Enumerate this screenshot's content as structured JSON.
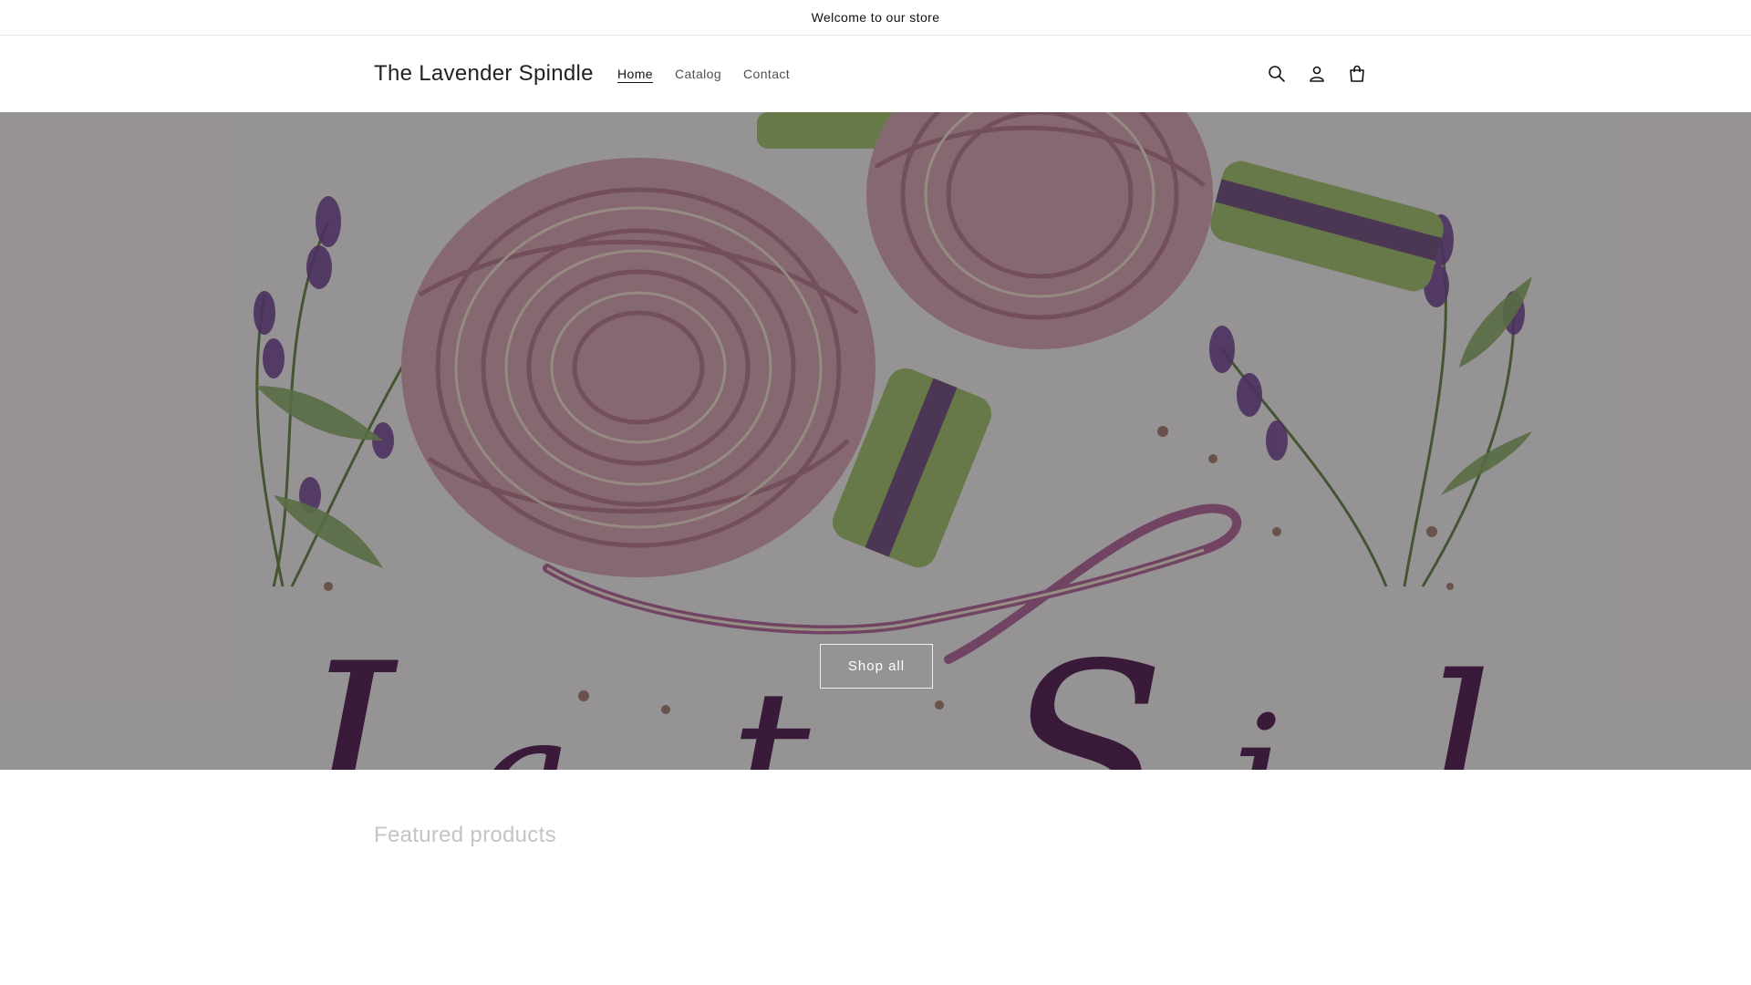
{
  "announcement": {
    "text": "Welcome to our store"
  },
  "header": {
    "logo": "The Lavender Spindle",
    "nav": [
      {
        "label": "Home",
        "active": true
      },
      {
        "label": "Catalog",
        "active": false
      },
      {
        "label": "Contact",
        "active": false
      }
    ],
    "icons": [
      "search-icon",
      "account-icon",
      "cart-icon"
    ]
  },
  "hero": {
    "button_label": "Shop all",
    "overlay_color": "#000000",
    "yarn_color": "#d9a9b6",
    "lavender_color": "#7a4f9a",
    "leaf_color": "#8fae6e",
    "needle_color": "#a6c276"
  },
  "featured": {
    "title": "Featured products"
  }
}
